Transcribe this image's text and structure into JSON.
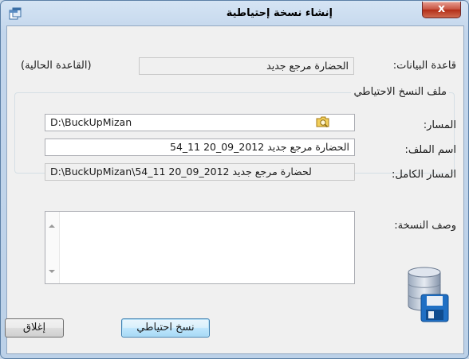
{
  "window": {
    "title": "إنشاء نسخة إحتياطية",
    "close_glyph": "x"
  },
  "form": {
    "database_label": "قاعدة البيانات:",
    "database_value": "الحضارة مرجع جديد",
    "current_db_note": "(القاعدة الحالية)",
    "backup_group_title": "ملف النسخ الاحتياطي",
    "path_label": "المسار:",
    "path_value": "D:\\BuckUpMizan",
    "filename_label": "اسم الملف:",
    "filename_value": "الحضارة مرجع جديد  2012_09_20  11_54",
    "fullpath_label": "المسار الكامل:",
    "fullpath_value": "D:\\BuckUpMizan\\54_11  20_09_2012  لحضارة مرجع جديد",
    "description_label": "وصف النسخة:",
    "description_value": ""
  },
  "buttons": {
    "backup": "نسخ احتياطي",
    "close": "إغلاق"
  },
  "icons": {
    "app": "window-restore-icon",
    "browse": "folder-browse-icon",
    "database": "database-save-icon"
  },
  "colors": {
    "title_close": "#c7513f",
    "default_button_border": "#3c7fb1",
    "disk_blue": "#1f6fc4"
  }
}
